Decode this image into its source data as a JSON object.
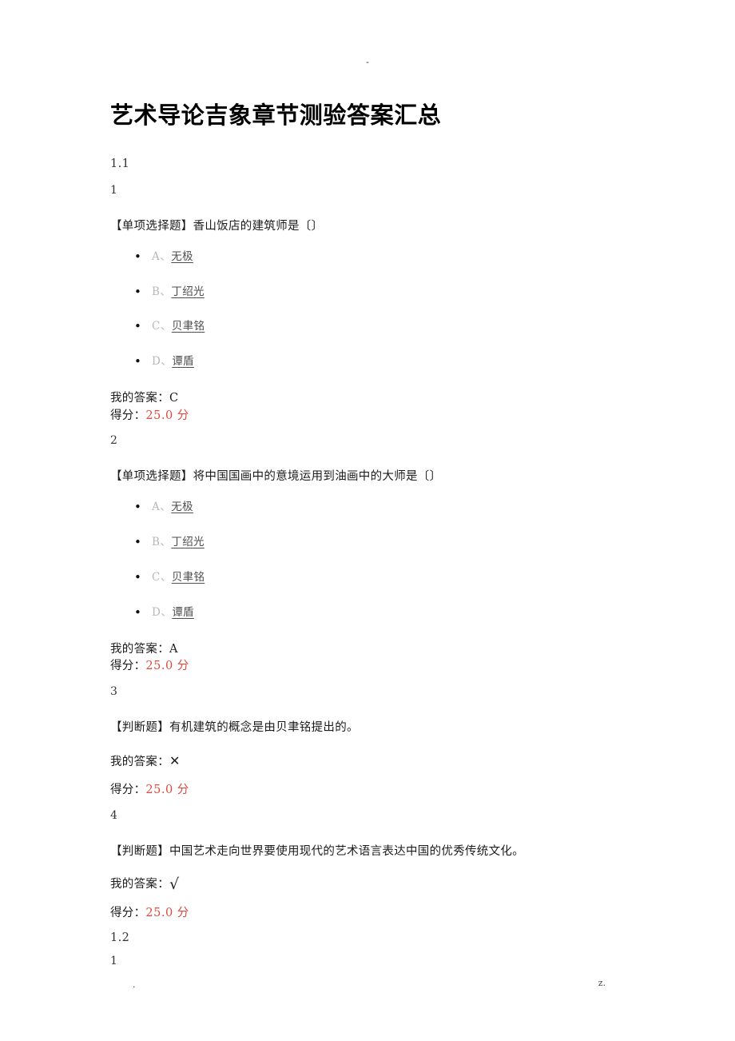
{
  "document": {
    "title": "艺术导论吉象章节测验答案汇总",
    "header_mark": "-",
    "footer_left_mark": ".",
    "footer_right_mark": "z."
  },
  "colors": {
    "score_red": "#dc4b3f",
    "option_letter_gray": "#b8b8b8",
    "option_value_gray": "#4d4d4d",
    "body_text": "#1c1c1c",
    "page_background": "#ffffff"
  },
  "labels": {
    "my_answer_prefix": "我的答案：",
    "score_prefix": "得分：",
    "single_choice_tag": "【单项选择题】",
    "true_false_tag": "【判断题】"
  },
  "sections": [
    {
      "id": "1.1",
      "label": "1.1",
      "questions": [
        {
          "number": "1",
          "type_tag": "【单项选择题】",
          "text": "香山饭店的建筑师是〔〕",
          "full_text": "【单项选择题】香山饭店的建筑师是〔〕",
          "options": [
            {
              "letter": "A、",
              "value": "无极"
            },
            {
              "letter": "B、",
              "value": "丁绍光"
            },
            {
              "letter": "C、",
              "value": "贝聿铭"
            },
            {
              "letter": "D、",
              "value": "谭盾"
            }
          ],
          "my_answer": "C",
          "score": "25.0 分"
        },
        {
          "number": "2",
          "type_tag": "【单项选择题】",
          "text": "将中国国画中的意境运用到油画中的大师是〔〕",
          "full_text": "【单项选择题】将中国国画中的意境运用到油画中的大师是〔〕",
          "options": [
            {
              "letter": "A、",
              "value": "无极"
            },
            {
              "letter": "B、",
              "value": "丁绍光"
            },
            {
              "letter": "C、",
              "value": "贝聿铭"
            },
            {
              "letter": "D、",
              "value": "谭盾"
            }
          ],
          "my_answer": "A",
          "score": "25.0 分"
        },
        {
          "number": "3",
          "type_tag": "【判断题】",
          "text": "有机建筑的概念是由贝聿铭提出的。",
          "full_text": "【判断题】有机建筑的概念是由贝聿铭提出的。",
          "options": [],
          "my_answer": "✕",
          "score": "25.0 分"
        },
        {
          "number": "4",
          "type_tag": "【判断题】",
          "text": "中国艺术走向世界要使用现代的艺术语言表达中国的优秀传统文化。",
          "full_text": "【判断题】中国艺术走向世界要使用现代的艺术语言表达中国的优秀传统文化。",
          "options": [],
          "my_answer": "√",
          "score": "25.0 分"
        }
      ]
    },
    {
      "id": "1.2",
      "label": "1.2",
      "questions": [
        {
          "number": "1",
          "type_tag": "",
          "text": "",
          "full_text": "",
          "options": [],
          "my_answer": "",
          "score": ""
        }
      ]
    }
  ]
}
